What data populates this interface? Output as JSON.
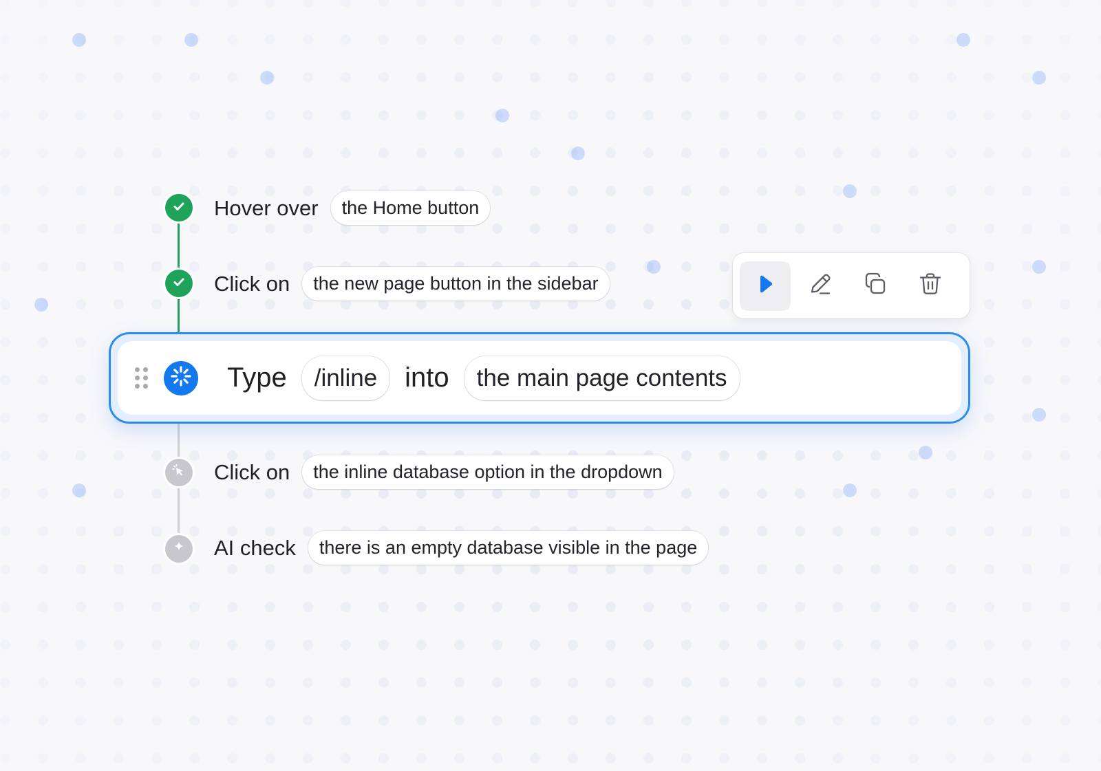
{
  "colors": {
    "success": "#1fa25a",
    "running": "#1479ef",
    "pending": "#c7c7cd",
    "active_border": "#2a8cf0"
  },
  "steps": [
    {
      "status": "done",
      "status_icon": "check-icon",
      "verb": "Hover over",
      "target": "the Home button"
    },
    {
      "status": "done",
      "status_icon": "check-icon",
      "verb": "Click on",
      "target": "the new page button in the sidebar"
    },
    {
      "status": "running",
      "status_icon": "spinner-icon",
      "verb": "Type",
      "value": "/inline",
      "connector": "into",
      "target": "the main page contents"
    },
    {
      "status": "pending",
      "status_icon": "cursor-click-icon",
      "verb": "Click on",
      "target": "the inline database option in the dropdown"
    },
    {
      "status": "pending",
      "status_icon": "sparkle-icon",
      "verb": "AI check",
      "target": "there is an empty database visible in the page"
    }
  ],
  "toolbar": {
    "buttons": [
      {
        "icon": "play-icon",
        "action": "run"
      },
      {
        "icon": "pencil-icon",
        "action": "edit"
      },
      {
        "icon": "copy-icon",
        "action": "duplicate"
      },
      {
        "icon": "trash-icon",
        "action": "delete"
      }
    ]
  }
}
